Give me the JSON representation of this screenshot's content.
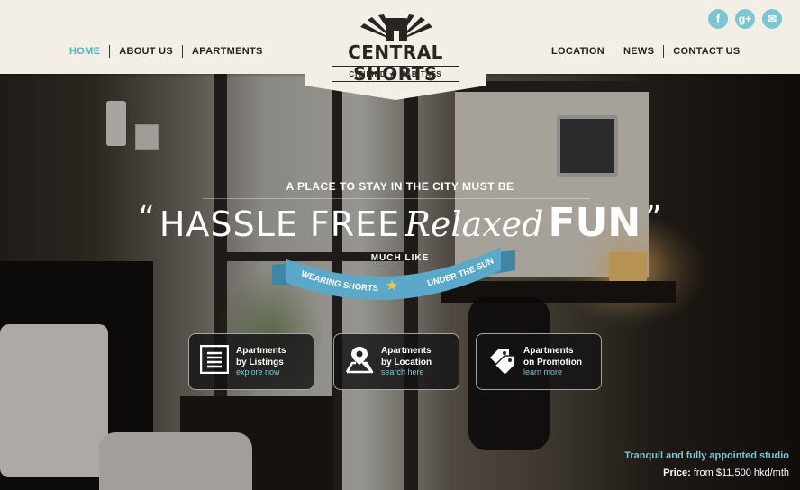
{
  "nav": {
    "left": [
      {
        "label": "HOME",
        "active": true
      },
      {
        "label": "ABOUT US"
      },
      {
        "label": "APARTMENTS"
      }
    ],
    "right": [
      {
        "label": "LOCATION"
      },
      {
        "label": "NEWS"
      },
      {
        "label": "CONTACT US"
      }
    ]
  },
  "social": {
    "facebook": "f",
    "googleplus": "g+",
    "email": "✉"
  },
  "logo": {
    "title": "CENTRAL SHORTS",
    "sub_left": "CITIFIED",
    "star": "★",
    "sub_right": "HABITATS"
  },
  "hero": {
    "tagline": "A PLACE TO STAY IN THE CITY MUST BE",
    "open_quote": "“",
    "headline_a": "HASSLE FREE",
    "headline_b": "Relaxed",
    "headline_c": "FUN",
    "close_quote": "”",
    "much_like": "MUCH LIKE",
    "ribbon_left": "WEARING SHORTS",
    "ribbon_right": "UNDER THE SUN"
  },
  "cta": [
    {
      "line1": "Apartments",
      "line2": "by Listings",
      "link": "explore now",
      "icon": "list-icon"
    },
    {
      "line1": "Apartments",
      "line2": "by Location",
      "link": "search here",
      "icon": "map-pin-icon"
    },
    {
      "line1": "Apartments",
      "line2": "on Promotion",
      "link": "learn more",
      "icon": "tags-icon"
    }
  ],
  "caption": {
    "studio": "Tranquil and fully appointed studio",
    "price_label": "Price:",
    "price_value": "from $11,500 hkd/mth"
  },
  "colors": {
    "accent": "#7dc6d0",
    "header_bg": "#f3efe7",
    "ribbon": "#5aa9c9",
    "star": "#f2c14e"
  }
}
